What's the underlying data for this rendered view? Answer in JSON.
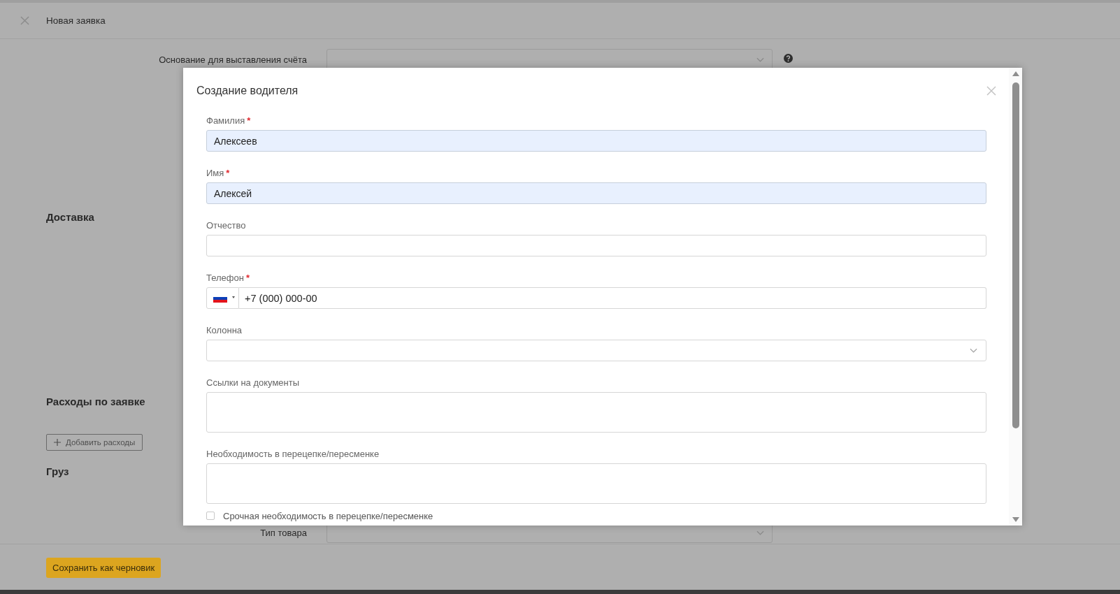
{
  "header": {
    "title": "Новая заявка"
  },
  "background_form": {
    "invoice_basis": {
      "label": "Основание для выставления счёта"
    },
    "sections": [
      {
        "title": "Доставка"
      },
      {
        "title": "Расходы по заявке",
        "button": "Добавить расходы"
      },
      {
        "title": "Груз"
      }
    ],
    "product_type": {
      "label": "Тип товара"
    }
  },
  "footer": {
    "buttons": [
      "Сохранить как черновик"
    ]
  },
  "dialog": {
    "title": "Создание водителя",
    "fields": [
      {
        "kind": "text",
        "label": "Фамилия",
        "required_mark": "*",
        "value": "Алексеев",
        "autofilled": true
      },
      {
        "kind": "text",
        "label": "Имя",
        "required_mark": "*",
        "value": "Алексей",
        "autofilled": true
      },
      {
        "kind": "text",
        "label": "Отчество",
        "autofilled": false
      },
      {
        "kind": "phone",
        "label": "Телефон",
        "required_mark": "*",
        "value": "+7 (000) 000-00"
      },
      {
        "kind": "select",
        "label": "Колонна"
      },
      {
        "kind": "textarea",
        "label": "Ссылки на документы"
      },
      {
        "kind": "textarea",
        "label": "Необходимость в перецепке/пересменке"
      },
      {
        "kind": "checkbox",
        "label": "Срочная необходимость в перецепке/пересменке",
        "checked": false
      }
    ]
  }
}
